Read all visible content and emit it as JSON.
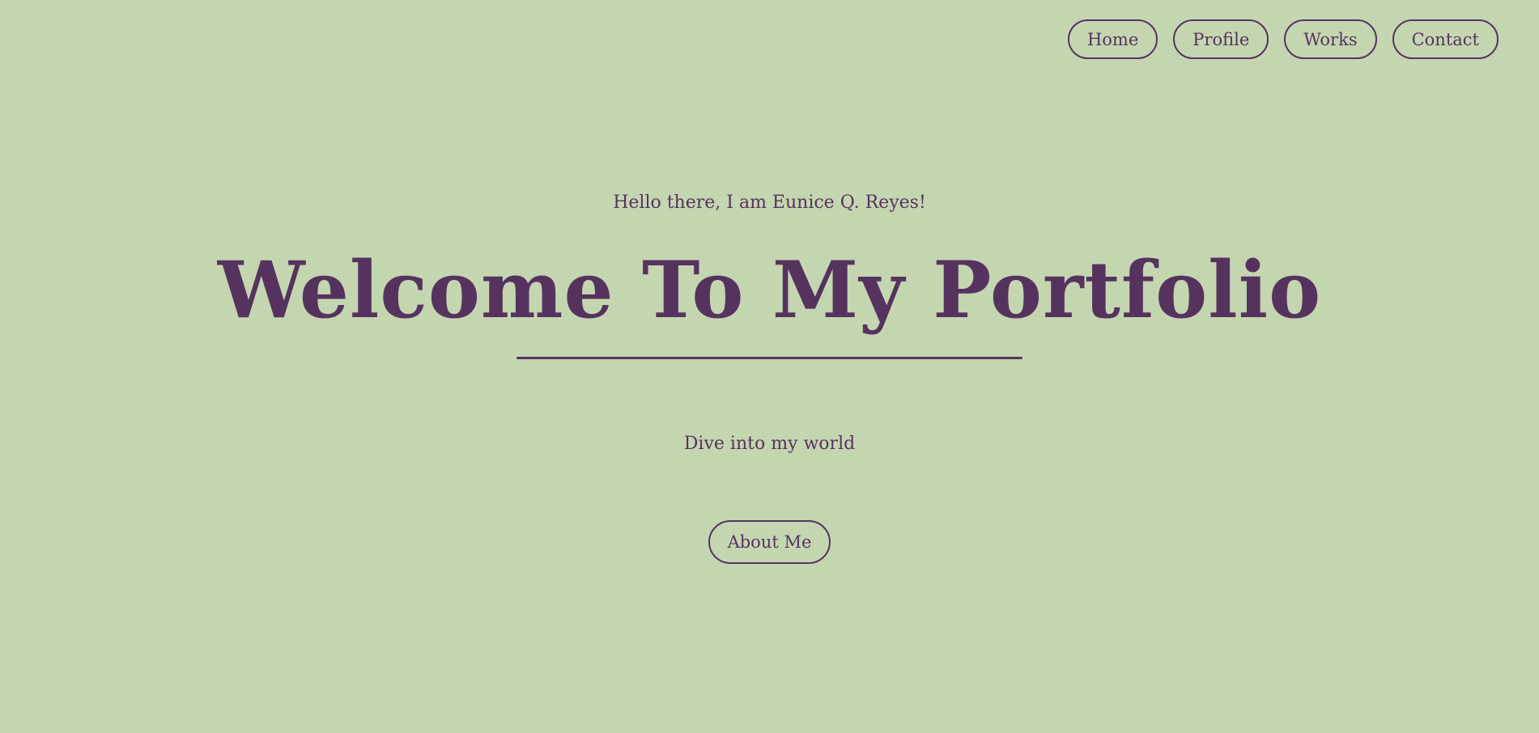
{
  "nav": {
    "items": [
      {
        "label": "Home"
      },
      {
        "label": "Profile"
      },
      {
        "label": "Works"
      },
      {
        "label": "Contact"
      }
    ]
  },
  "hero": {
    "greeting": "Hello there, I am Eunice Q. Reyes!",
    "title": "Welcome To My Portfolio",
    "tagline": "Dive into my world",
    "cta_label": "About Me"
  },
  "colors": {
    "background": "#c4d6b0",
    "accent": "#56335f"
  }
}
